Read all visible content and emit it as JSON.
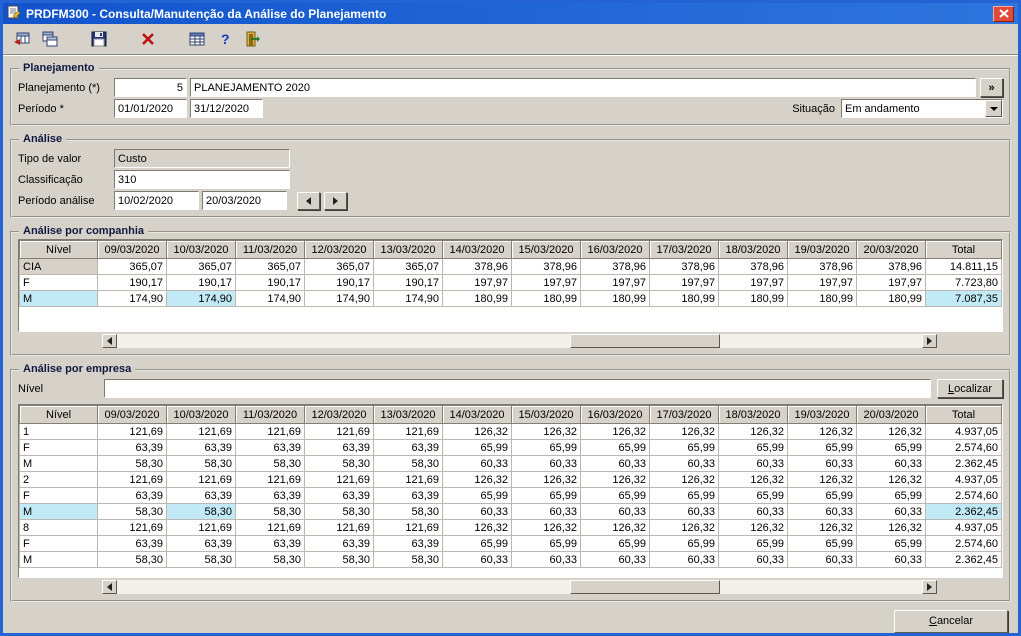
{
  "window": {
    "title": "PRDFM300 - Consulta/Manutenção da Análise do Planejamento"
  },
  "toolbar": {
    "icons": [
      "navigate-record-icon",
      "copy-record-icon",
      "save-icon",
      "delete-icon",
      "grid-icon",
      "help-icon",
      "exit-icon"
    ]
  },
  "planejamento": {
    "group_label": "Planejamento",
    "planejamento_label": "Planejamento (*)",
    "codigo": "5",
    "descricao": "PLANEJAMENTO 2020",
    "lookup_button": "»",
    "periodo_label": "Período *",
    "periodo_inicio": "01/01/2020",
    "periodo_fim": "31/12/2020",
    "situacao_label": "Situação",
    "situacao_value": "Em andamento"
  },
  "analise": {
    "group_label": "Análise",
    "tipo_valor_label": "Tipo de valor",
    "tipo_valor": "Custo",
    "classificacao_label": "Classificação",
    "classificacao": "310",
    "periodo_analise_label": "Período análise",
    "periodo_analise_inicio": "10/02/2020",
    "periodo_analise_fim": "20/03/2020"
  },
  "companhia": {
    "group_label": "Análise por companhia",
    "columns": [
      "Nível",
      "09/03/2020",
      "10/03/2020",
      "11/03/2020",
      "12/03/2020",
      "13/03/2020",
      "14/03/2020",
      "15/03/2020",
      "16/03/2020",
      "17/03/2020",
      "18/03/2020",
      "19/03/2020",
      "20/03/2020",
      "Total"
    ],
    "rows": [
      {
        "nivel": "CIA",
        "fixed": true,
        "values": [
          "365,07",
          "365,07",
          "365,07",
          "365,07",
          "365,07",
          "378,96",
          "378,96",
          "378,96",
          "378,96",
          "378,96",
          "378,96",
          "378,96"
        ],
        "total": "14.811,15"
      },
      {
        "nivel": "F",
        "values": [
          "190,17",
          "190,17",
          "190,17",
          "190,17",
          "190,17",
          "197,97",
          "197,97",
          "197,97",
          "197,97",
          "197,97",
          "197,97",
          "197,97"
        ],
        "total": "7.723,80"
      },
      {
        "nivel": "M",
        "values": [
          "174,90",
          "174,90",
          "174,90",
          "174,90",
          "174,90",
          "180,99",
          "180,99",
          "180,99",
          "180,99",
          "180,99",
          "180,99",
          "180,99"
        ],
        "total": "7.087,35"
      }
    ],
    "selected": {
      "row": 2,
      "col": 1
    }
  },
  "empresa": {
    "group_label": "Análise por empresa",
    "nivel_label": "Nível",
    "nivel_value": "",
    "localizar_accel": "L",
    "localizar_rest": "ocalizar",
    "columns": [
      "Nível",
      "09/03/2020",
      "10/03/2020",
      "11/03/2020",
      "12/03/2020",
      "13/03/2020",
      "14/03/2020",
      "15/03/2020",
      "16/03/2020",
      "17/03/2020",
      "18/03/2020",
      "19/03/2020",
      "20/03/2020",
      "Total"
    ],
    "rows": [
      {
        "nivel": "1",
        "values": [
          "121,69",
          "121,69",
          "121,69",
          "121,69",
          "121,69",
          "126,32",
          "126,32",
          "126,32",
          "126,32",
          "126,32",
          "126,32",
          "126,32"
        ],
        "total": "4.937,05"
      },
      {
        "nivel": "F",
        "values": [
          "63,39",
          "63,39",
          "63,39",
          "63,39",
          "63,39",
          "65,99",
          "65,99",
          "65,99",
          "65,99",
          "65,99",
          "65,99",
          "65,99"
        ],
        "total": "2.574,60"
      },
      {
        "nivel": "M",
        "values": [
          "58,30",
          "58,30",
          "58,30",
          "58,30",
          "58,30",
          "60,33",
          "60,33",
          "60,33",
          "60,33",
          "60,33",
          "60,33",
          "60,33"
        ],
        "total": "2.362,45"
      },
      {
        "nivel": "2",
        "values": [
          "121,69",
          "121,69",
          "121,69",
          "121,69",
          "121,69",
          "126,32",
          "126,32",
          "126,32",
          "126,32",
          "126,32",
          "126,32",
          "126,32"
        ],
        "total": "4.937,05"
      },
      {
        "nivel": "F",
        "values": [
          "63,39",
          "63,39",
          "63,39",
          "63,39",
          "63,39",
          "65,99",
          "65,99",
          "65,99",
          "65,99",
          "65,99",
          "65,99",
          "65,99"
        ],
        "total": "2.574,60"
      },
      {
        "nivel": "M",
        "values": [
          "58,30",
          "58,30",
          "58,30",
          "58,30",
          "58,30",
          "60,33",
          "60,33",
          "60,33",
          "60,33",
          "60,33",
          "60,33",
          "60,33"
        ],
        "total": "2.362,45"
      },
      {
        "nivel": "8",
        "values": [
          "121,69",
          "121,69",
          "121,69",
          "121,69",
          "121,69",
          "126,32",
          "126,32",
          "126,32",
          "126,32",
          "126,32",
          "126,32",
          "126,32"
        ],
        "total": "4.937,05"
      },
      {
        "nivel": "F",
        "values": [
          "63,39",
          "63,39",
          "63,39",
          "63,39",
          "63,39",
          "65,99",
          "65,99",
          "65,99",
          "65,99",
          "65,99",
          "65,99",
          "65,99"
        ],
        "total": "2.574,60"
      },
      {
        "nivel": "M",
        "values": [
          "58,30",
          "58,30",
          "58,30",
          "58,30",
          "58,30",
          "60,33",
          "60,33",
          "60,33",
          "60,33",
          "60,33",
          "60,33",
          "60,33"
        ],
        "total": "2.362,45"
      }
    ],
    "selected": {
      "row": 5,
      "col": 1
    }
  },
  "footer": {
    "cancel_accel": "C",
    "cancel_rest": "ancelar"
  }
}
